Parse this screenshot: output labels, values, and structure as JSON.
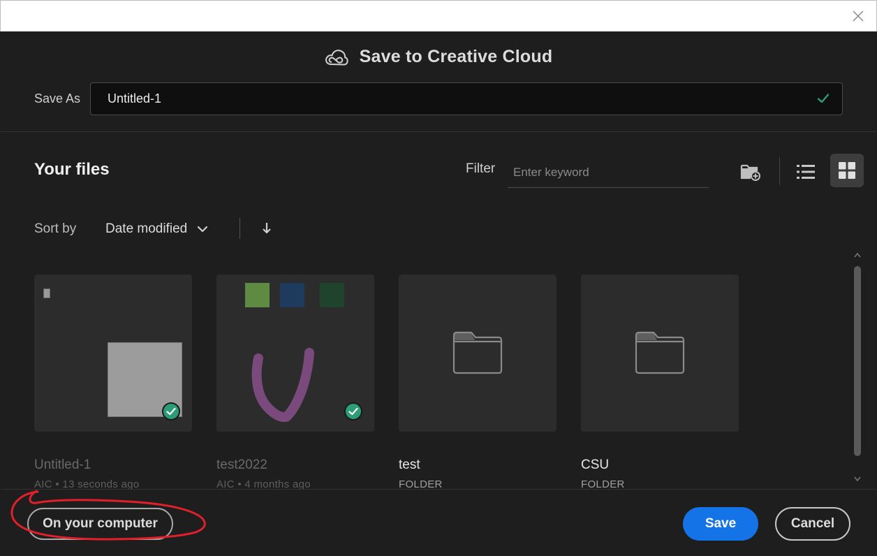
{
  "dialog": {
    "title": "Save to Creative Cloud",
    "save_as_label": "Save As",
    "file_name_value": "Untitled-1"
  },
  "files": {
    "heading": "Your files",
    "filter_label": "Filter",
    "filter_placeholder": "Enter keyword",
    "sort_label": "Sort by",
    "sort_value": "Date modified",
    "view_mode": "grid",
    "items": [
      {
        "name": "Untitled-1",
        "meta": "AIC • 13 seconds ago",
        "kind": "file",
        "synced": true
      },
      {
        "name": "test2022",
        "meta": "AIC • 4 months ago",
        "kind": "file",
        "synced": true
      },
      {
        "name": "test",
        "meta": "FOLDER",
        "kind": "folder"
      },
      {
        "name": "CSU",
        "meta": "FOLDER",
        "kind": "folder"
      }
    ]
  },
  "footer": {
    "on_computer_label": "On your computer",
    "save_label": "Save",
    "cancel_label": "Cancel"
  },
  "colors": {
    "background": "#1e1e1e",
    "accent": "#1473e6",
    "synced_badge": "#2d9d78",
    "annotation": "#e0202a",
    "check": "#2d9d78"
  },
  "icons": [
    "close-icon",
    "creative-cloud-icon",
    "check-icon",
    "new-folder-icon",
    "list-view-icon",
    "grid-view-icon",
    "chevron-down-icon",
    "arrow-down-icon",
    "folder-icon"
  ]
}
